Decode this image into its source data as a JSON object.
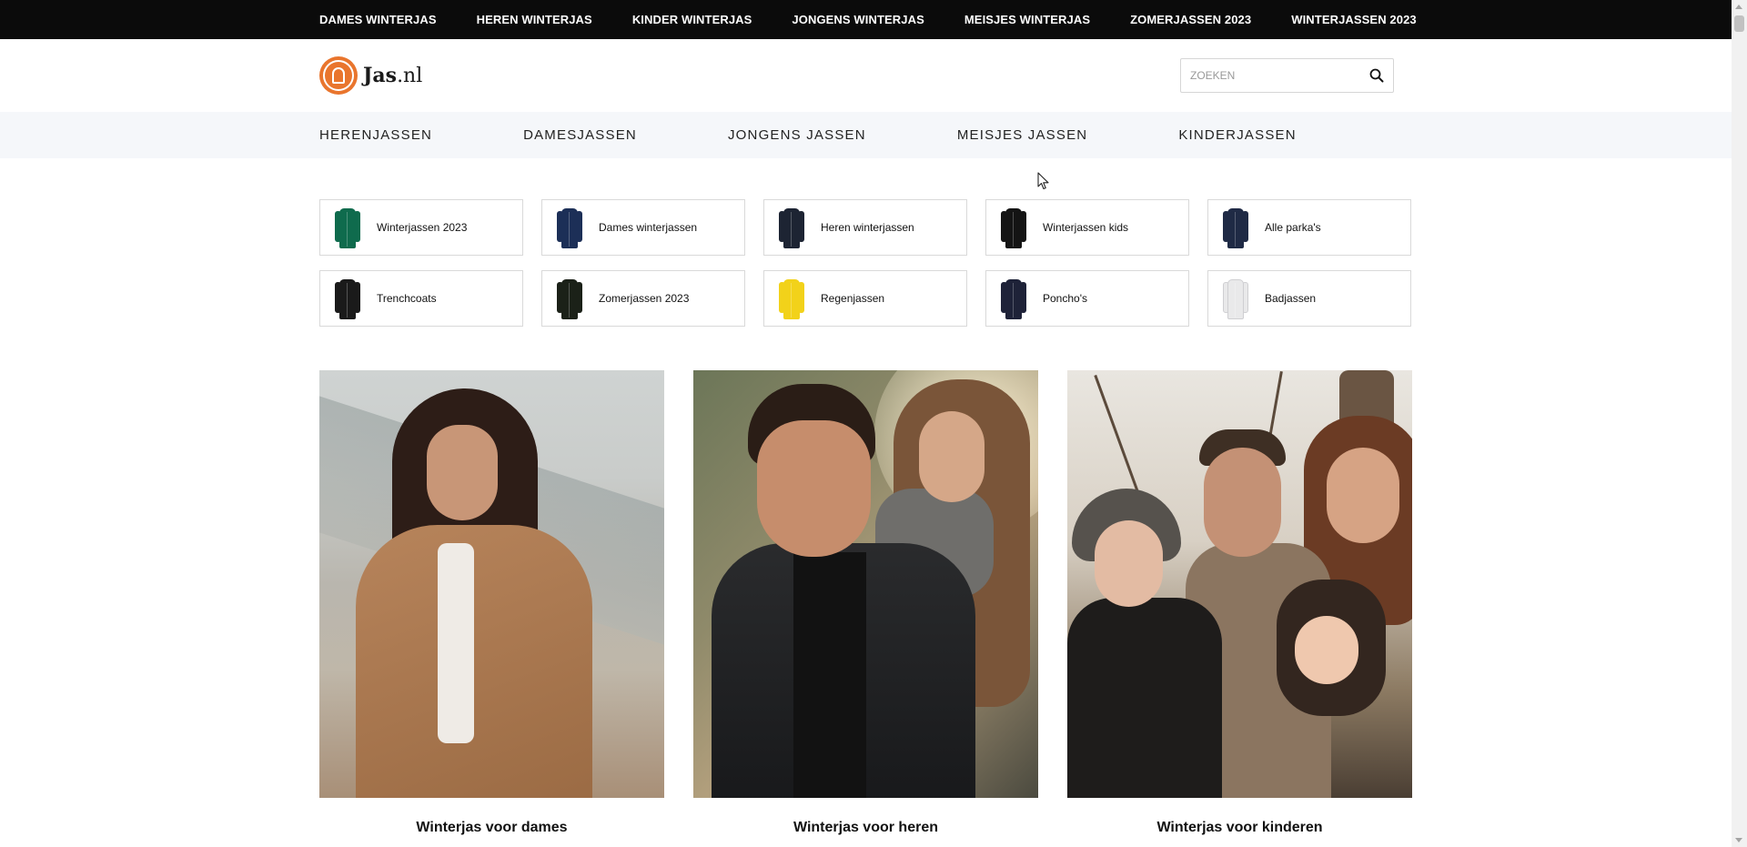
{
  "topbar": {
    "links": [
      "DAMES WINTERJAS",
      "HEREN WINTERJAS",
      "KINDER WINTERJAS",
      "JONGENS WINTERJAS",
      "MEISJES WINTERJAS",
      "ZOMERJASSEN 2023",
      "WINTERJASSEN 2023"
    ]
  },
  "header": {
    "logo_bold": "Jas",
    "logo_suffix": ".nl",
    "search_placeholder": "ZOEKEN",
    "search_value": "",
    "search_icon": "search-icon"
  },
  "mainnav": {
    "items": [
      "HERENJASSEN",
      "DAMESJASSEN",
      "JONGENS JASSEN",
      "MEISJES JASSEN",
      "KINDERJASSEN"
    ]
  },
  "categories": [
    {
      "label": "Winterjassen 2023",
      "color": "#0f6b4d"
    },
    {
      "label": "Dames winterjassen",
      "color": "#1c2f57"
    },
    {
      "label": "Heren winterjassen",
      "color": "#1d2433"
    },
    {
      "label": "Winterjassen kids",
      "color": "#141414"
    },
    {
      "label": "Alle parka's",
      "color": "#1f2a45"
    },
    {
      "label": "Trenchcoats",
      "color": "#1a1a1a"
    },
    {
      "label": "Zomerjassen 2023",
      "color": "#1b2118"
    },
    {
      "label": "Regenjassen",
      "color": "#f2d21a"
    },
    {
      "label": "Poncho's",
      "color": "#1e2238"
    },
    {
      "label": "Badjassen",
      "color": "#e9e9ea"
    }
  ],
  "features": [
    {
      "caption": "Winterjas voor dames"
    },
    {
      "caption": "Winterjas voor heren"
    },
    {
      "caption": "Winterjas voor kinderen"
    }
  ],
  "colors": {
    "topbar_bg": "#0b0b0b",
    "nav_bg": "#f5f7fa",
    "logo_accent": "#e9752d"
  }
}
